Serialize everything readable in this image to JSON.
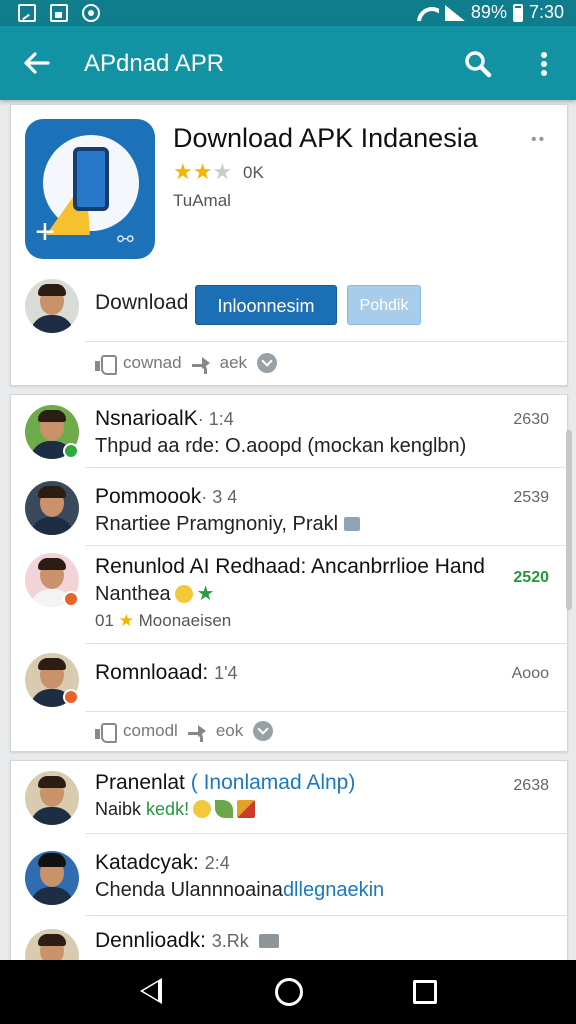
{
  "status_bar": {
    "battery_text": "89%",
    "time": "7:30"
  },
  "app_bar": {
    "title": "APdnad APR"
  },
  "app_card": {
    "app_name": "Download APK Indanesia",
    "rating_stars": 2,
    "rating_text": "0K",
    "developer": "TuAmal",
    "download_label": "Download",
    "primary_button": "Inloonnesim",
    "secondary_button": "Pohdik",
    "actions": {
      "like": "cownad",
      "share": "aek"
    }
  },
  "card2": {
    "rows": [
      {
        "name": "NsnarioalK",
        "meta": "· 1:4",
        "text": "Thpud aa rde: O.aoopd (mockan kenglbn)",
        "count": "2630"
      },
      {
        "name": "Pommoook",
        "meta": "· 3 4",
        "text": "Rnartiee Pramgnoniy, Prakl",
        "count": "2539"
      },
      {
        "name": "Renunlod AI Redhaad: Ancanbrrlioe Hand",
        "text": "Nanthea",
        "sub": "01",
        "sub2": "Moonaeisen",
        "count": "2520"
      },
      {
        "name": "Romnloaad:",
        "meta": "1'4",
        "count": "Aooo"
      }
    ],
    "actions": {
      "like": "comodl",
      "share": "eok"
    }
  },
  "card3": {
    "rows": [
      {
        "name": "Pranenlat",
        "link": "( Inonlamad Alnp)",
        "text": "Naibk",
        "text_green": "kedk!",
        "count": "2638"
      },
      {
        "name": "Katadcyak:",
        "meta": "2:4",
        "text": "Chenda Ulannnoaina",
        "text_blue": "dllegnaekin"
      },
      {
        "name": "Dennlioadk:",
        "meta": "3.Rk"
      }
    ]
  }
}
